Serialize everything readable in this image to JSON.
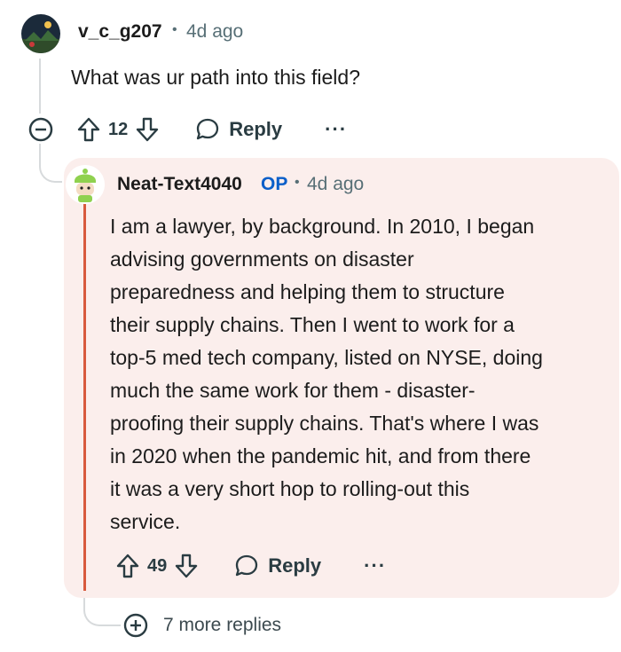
{
  "comment": {
    "author": "v_c_g207",
    "separator": "•",
    "time": "4d ago",
    "text": "What was ur path into this field?",
    "votes": "12",
    "reply_label": "Reply",
    "more_label": "···"
  },
  "reply": {
    "author": "Neat-Text4040",
    "op_tag": "OP",
    "separator": "•",
    "time": "4d ago",
    "lines": [
      "I am a lawyer, by background. In 2010, I began",
      "advising governments on disaster",
      "preparedness and helping them to structure",
      "their supply chains. Then I went to work for a",
      "top-5 med tech company, listed on NYSE, doing",
      "much the same work for them - disaster-",
      "proofing their supply chains. That's where I was",
      "in 2020 when the pandemic hit, and from there",
      "it was a very short hop to rolling-out this",
      "service."
    ],
    "votes": "49",
    "reply_label": "Reply",
    "more_label": "···"
  },
  "more_replies": {
    "label": "7 more replies"
  },
  "icons": {
    "collapse": "collapse-minus-icon",
    "upvote": "upvote-arrow-icon",
    "downvote": "downvote-arrow-icon",
    "reply": "speech-bubble-icon",
    "more": "ellipsis-icon",
    "expand": "expand-plus-icon"
  }
}
